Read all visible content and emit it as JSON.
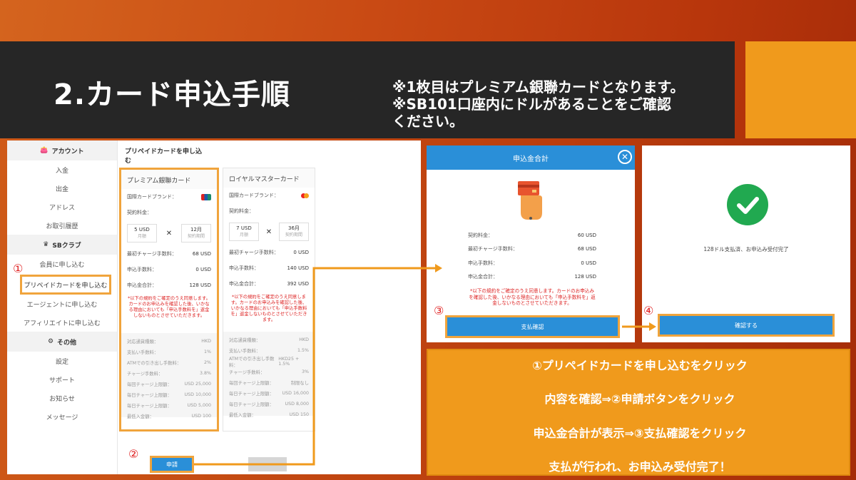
{
  "slide": {
    "title": "2.カード申込手順",
    "notes": [
      "※1枚目はプレミアム銀聯カードとなります。",
      "※SB101口座内にドルがあることをご確認",
      "ください。"
    ]
  },
  "app": {
    "sidebar": {
      "account_header": "アカウント",
      "account_items": [
        "入金",
        "出金",
        "アドレス",
        "お取引履歴"
      ],
      "club_header": "SBクラブ",
      "club_items": [
        "会員に申し込む",
        "プリペイドカードを申し込む",
        "エージェントに申し込む",
        "アフィリエイトに申し込む"
      ],
      "other_header": "その他",
      "other_items": [
        "設定",
        "サポート",
        "お知らせ",
        "メッセージ"
      ]
    },
    "tab": "プリペイドカードを申し込む",
    "cards": [
      {
        "title": "プレミアム銀聯カード",
        "brand_label": "国際カードブランド：",
        "fee_label": "契約料金：",
        "fee_amount": "5 USD",
        "fee_unit": "月額",
        "term_amount": "12月",
        "term_unit": "契約期間",
        "initial_label": "最初チャージ手数料：",
        "initial_value": "68 USD",
        "apply_fee_label": "申込手数料：",
        "apply_fee_value": "0 USD",
        "total_label": "申込金合計：",
        "total_value": "128 USD",
        "note": "*以下の規約をご確定のうえ同意します。カードのお申込みを確認した後、いかなる理由においても「申込手数料を」返金しないものとさせていただきます。",
        "details": [
          [
            "対応通貨種類：",
            "HKD"
          ],
          [
            "支払い手数料：",
            "1%"
          ],
          [
            "ATMでの引き出し手数料：",
            "2%"
          ],
          [
            "チャージ手数料：",
            "3.8%"
          ],
          [
            "毎回チャージ上限額：",
            "USD 25,000"
          ],
          [
            "毎日チャージ上限額：",
            "USD 10,000"
          ],
          [
            "毎日チャージ上限額：",
            "USD 5,000"
          ],
          [
            "最低入金額：",
            "USD 100"
          ]
        ],
        "apply_button": "申請"
      },
      {
        "title": "ロイヤルマスターカード",
        "brand_label": "国際カードブランド：",
        "fee_label": "契約料金：",
        "fee_amount": "7 USD",
        "fee_unit": "月額",
        "term_amount": "36月",
        "term_unit": "契約期間",
        "initial_label": "最初チャージ手数料：",
        "initial_value": "0 USD",
        "apply_fee_label": "申込手数料：",
        "apply_fee_value": "140 USD",
        "total_label": "申込金合計：",
        "total_value": "392 USD",
        "note": "*以下の規約をご確定のうえ同意します。カードのお申込みを確認した後、いかなる理由においても「申込手数料を」返金しないものとさせていただきます。",
        "details": [
          [
            "対応通貨種類：",
            "HKD"
          ],
          [
            "支払い手数料：",
            "1.5%"
          ],
          [
            "ATMでの引き出し手数料：",
            "HKD25 + 1.5%"
          ],
          [
            "チャージ手数料：",
            "3%"
          ],
          [
            "毎回チャージ上限額：",
            "制限なし"
          ],
          [
            "毎日チャージ上限額：",
            "USD 16,000"
          ],
          [
            "毎日チャージ上限額：",
            "USD 8,000"
          ],
          [
            "最低入金額：",
            "USD 150"
          ]
        ]
      }
    ]
  },
  "modal": {
    "title": "申込金合計",
    "rows": [
      [
        "契約料金：",
        "60 USD"
      ],
      [
        "最初チャージ手数料：",
        "68 USD"
      ],
      [
        "申込手数料：",
        "0 USD"
      ],
      [
        "申込金合計：",
        "128 USD"
      ]
    ],
    "note": "*以下の規約をご確定のうえ同意します。カードのお申込みを確認した後、いかなる理由においても「申込手数料を」返金しないものとさせていただきます。",
    "confirm_button": "支払確認"
  },
  "complete": {
    "message": "128ドル支払済、お申込み受付完了",
    "button": "確認する"
  },
  "markers": [
    "①",
    "②",
    "③",
    "④"
  ],
  "instructions": [
    "①プリペイドカードを申し込むをクリック",
    "内容を確認⇒②申請ボタンをクリック",
    "申込金合計が表示⇒③支払確認をクリック",
    "支払が行われ、お申込み受付完了！"
  ],
  "colors": {
    "title_bar": "#262626",
    "accent_orange": "#f09a1c",
    "highlight_border": "#f0a43c",
    "button_blue": "#2a8fd8",
    "success_green": "#21a950",
    "warning_red": "#d22222"
  }
}
